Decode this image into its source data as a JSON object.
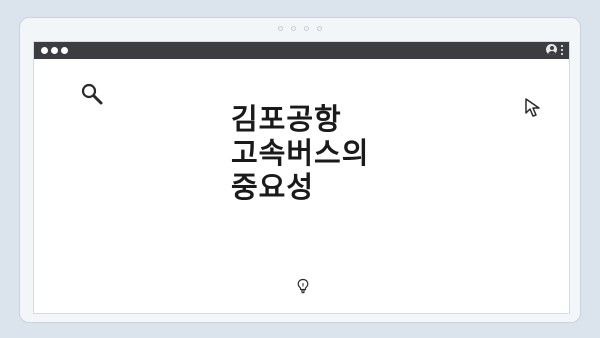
{
  "window": {
    "title_lines": [
      "김포공항",
      "고속버스의",
      "중요성"
    ]
  },
  "icons": {
    "search": "search-icon",
    "cursor": "cursor-icon",
    "lightbulb": "lightbulb-icon",
    "account": "account-icon",
    "menu": "more-vert-icon"
  }
}
